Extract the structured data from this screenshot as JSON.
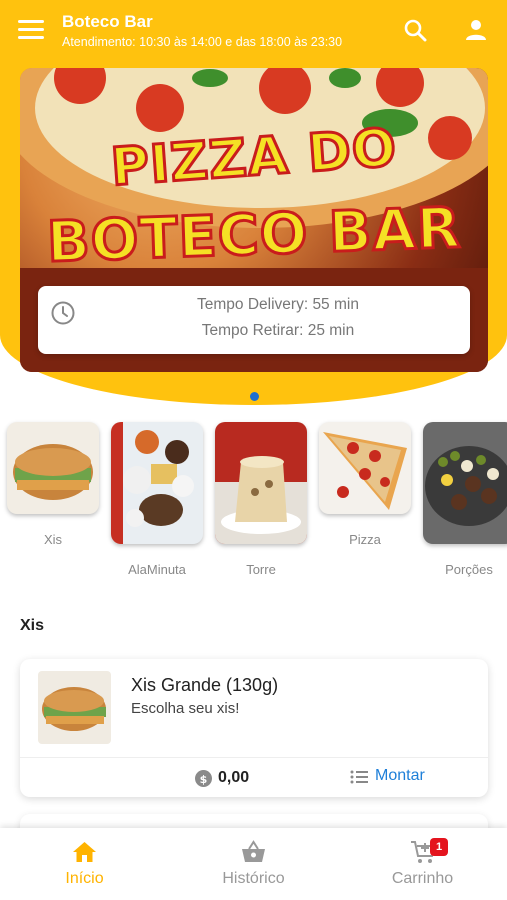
{
  "header": {
    "title": "Boteco Bar",
    "subtitle": "Atendimento: 10:30 às 14:00 e das 18:00 às 23:30"
  },
  "banner": {
    "line1": "Tempo Delivery: 55 min",
    "line2": "Tempo Retirar: 25 min",
    "logo_text": [
      "PIZZA DO",
      "BOTECO BAR"
    ]
  },
  "categories": [
    {
      "label": "Xis"
    },
    {
      "label": "AlaMinuta"
    },
    {
      "label": "Torre"
    },
    {
      "label": "Pizza"
    },
    {
      "label": "Porções"
    }
  ],
  "section": {
    "title": "Xis"
  },
  "product": {
    "title": "Xis Grande (130g)",
    "description": "Escolha seu xis!",
    "price": "0,00",
    "action_label": "Montar"
  },
  "bottom_nav": {
    "items": [
      {
        "label": "Início",
        "icon": "home-icon"
      },
      {
        "label": "Histórico",
        "icon": "basket-icon"
      },
      {
        "label": "Carrinho",
        "icon": "cart-icon"
      }
    ],
    "cart_badge": "1"
  },
  "colors": {
    "brand_yellow": "#FFC20E",
    "active_nav": "#FFB300",
    "link_blue": "#1E7FD8",
    "badge_red": "#E4141E"
  }
}
